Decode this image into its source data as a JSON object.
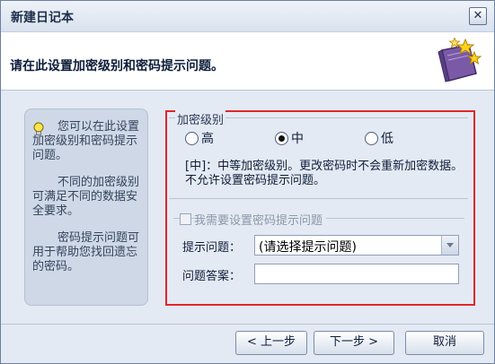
{
  "window": {
    "title": "新建日记本",
    "close_glyph": "✕"
  },
  "header": {
    "instruction": "请在此设置加密级别和密码提示问题。",
    "icon": "book-with-stars-icon"
  },
  "hint": {
    "icon": "lightbulb-icon",
    "para1": "您可以在此设置加密级别和密码提示问题。",
    "para2": "不同的加密级别可满足不同的数据安全要求。",
    "para3": "密码提示问题可用于帮助您找回遗忘的密码。"
  },
  "encryption": {
    "legend": "加密级别",
    "options": [
      {
        "label": "高",
        "selected": false
      },
      {
        "label": "中",
        "selected": true
      },
      {
        "label": "低",
        "selected": false
      }
    ],
    "description": "[中]：中等加密级别。更改密码时不会重新加密数据。不允许设置密码提示问题。"
  },
  "hint_question": {
    "checkbox_label": "我需要设置密码提示问题",
    "checked": false,
    "enabled": false,
    "question_label": "提示问题：",
    "question_value": "(请选择提示问题)",
    "answer_label": "问题答案：",
    "answer_value": ""
  },
  "footer": {
    "back": "< 上一步",
    "next": "下一步 >",
    "cancel": "取消"
  },
  "colors": {
    "highlight_border": "#e0262a",
    "dialog_bg": "#e4eaf3",
    "header_bg": "#ffffff"
  }
}
